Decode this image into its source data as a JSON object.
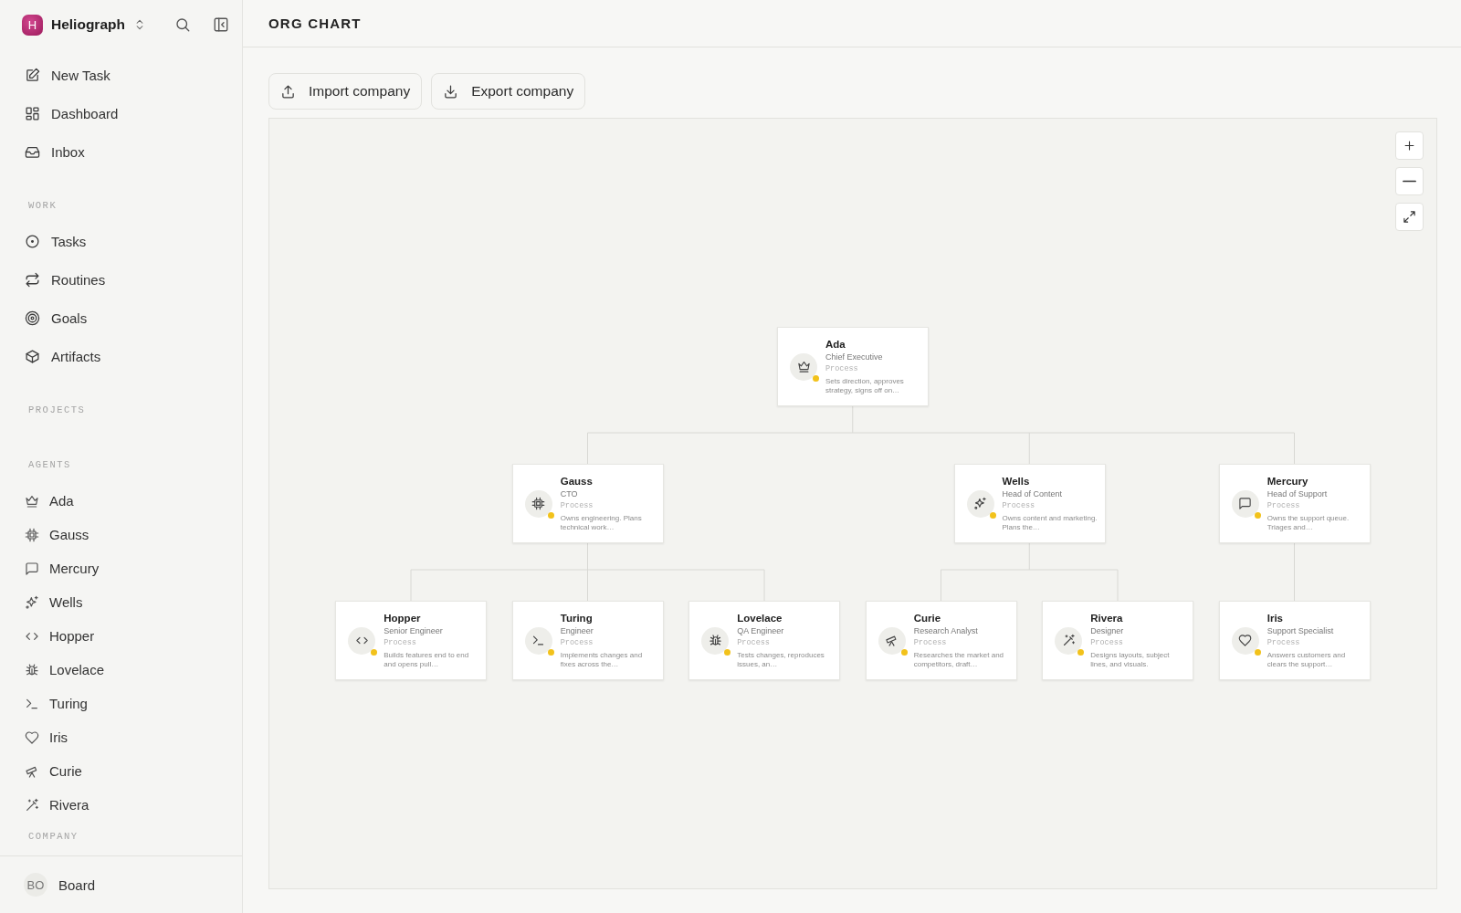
{
  "sidebar": {
    "workspace": {
      "logo": "H",
      "name": "Heliograph"
    },
    "nav": [
      {
        "label": "New Task"
      },
      {
        "label": "Dashboard"
      },
      {
        "label": "Inbox"
      }
    ],
    "sections": [
      {
        "title": "WORK",
        "items": [
          {
            "label": "Tasks"
          },
          {
            "label": "Routines"
          },
          {
            "label": "Goals"
          },
          {
            "label": "Artifacts"
          }
        ]
      },
      {
        "title": "PROJECTS"
      },
      {
        "title": "AGENTS",
        "items": [
          {
            "label": "Ada"
          },
          {
            "label": "Gauss"
          },
          {
            "label": "Mercury"
          },
          {
            "label": "Wells"
          },
          {
            "label": "Hopper"
          },
          {
            "label": "Lovelace"
          },
          {
            "label": "Turing"
          },
          {
            "label": "Iris"
          },
          {
            "label": "Curie"
          },
          {
            "label": "Rivera"
          }
        ]
      },
      {
        "title": "COMPANY"
      }
    ],
    "footer": {
      "avatar": "BO",
      "label": "Board"
    }
  },
  "header": {
    "title": "ORG CHART"
  },
  "actions": [
    {
      "label": "Import company"
    },
    {
      "label": "Export company"
    }
  ],
  "org_chart": {
    "root": {
      "name": "Ada",
      "role": "Chief Executive",
      "type": "Process",
      "description": "Sets direction, approves strategy, signs off on…",
      "color": "#f2c21b",
      "children": [
        {
          "name": "Gauss",
          "role": "CTO",
          "type": "Process",
          "description": "Owns engineering. Plans technical work…",
          "color": "#f2c21b",
          "children": [
            {
              "name": "Hopper",
              "role": "Senior Engineer",
              "type": "Process",
              "description": "Builds features end to end and opens pull…",
              "color": "#f2c21b"
            },
            {
              "name": "Turing",
              "role": "Engineer",
              "type": "Process",
              "description": "Implements changes and fixes across the…",
              "color": "#f2c21b"
            },
            {
              "name": "Lovelace",
              "role": "QA Engineer",
              "type": "Process",
              "description": "Tests changes, reproduces issues, an…",
              "color": "#f2c21b"
            }
          ]
        },
        {
          "name": "Wells",
          "role": "Head of Content",
          "type": "Process",
          "description": "Owns content and marketing. Plans the…",
          "color": "#f2c21b",
          "children": [
            {
              "name": "Curie",
              "role": "Research Analyst",
              "type": "Process",
              "description": "Researches the market and competitors, draft…",
              "color": "#f2c21b"
            },
            {
              "name": "Rivera",
              "role": "Designer",
              "type": "Process",
              "description": "Designs layouts, subject lines, and visuals.",
              "color": "#f2c21b"
            }
          ]
        },
        {
          "name": "Mercury",
          "role": "Head of Support",
          "type": "Process",
          "description": "Owns the support queue. Triages and…",
          "color": "#f2c21b",
          "children": [
            {
              "name": "Iris",
              "role": "Support Specialist",
              "type": "Process",
              "description": "Answers customers and clears the support…",
              "color": "#f2c21b"
            }
          ]
        }
      ]
    }
  }
}
